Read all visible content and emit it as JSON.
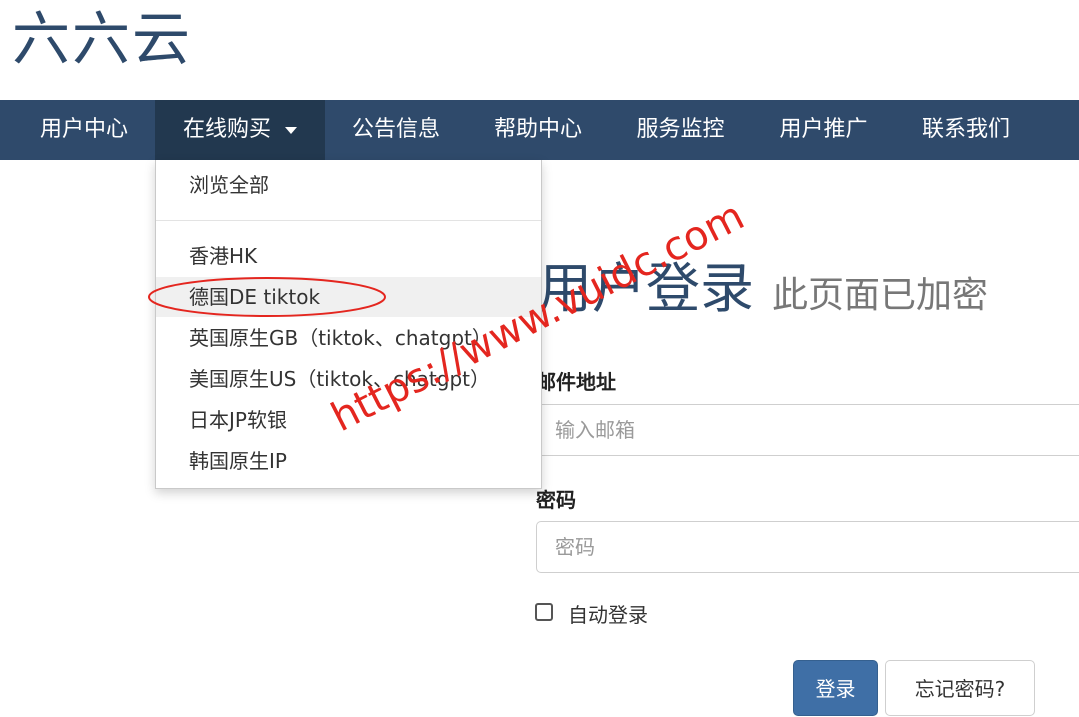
{
  "brand": {
    "name": "六六云"
  },
  "nav": {
    "items": [
      {
        "label": "用户中心"
      },
      {
        "label": "在线购买"
      },
      {
        "label": "公告信息"
      },
      {
        "label": "帮助中心"
      },
      {
        "label": "服务监控"
      },
      {
        "label": "用户推广"
      },
      {
        "label": "联系我们"
      }
    ],
    "dropdown": [
      {
        "label": "浏览全部"
      },
      {
        "label": "香港HK"
      },
      {
        "label": "德国DE tiktok"
      },
      {
        "label": "英国原生GB（tiktok、chatgpt）"
      },
      {
        "label": "美国原生US（tiktok、chatgpt）"
      },
      {
        "label": "日本JP软银"
      },
      {
        "label": "韩国原生IP"
      }
    ]
  },
  "login": {
    "title": "用户登录",
    "subtitle": "此页面已加密",
    "email_label": "邮件地址",
    "email_placeholder": "输入邮箱",
    "password_label": "密码",
    "password_placeholder": "密码",
    "remember_label": "自动登录",
    "submit_label": "登录",
    "forgot_label": "忘记密码?"
  },
  "watermark": {
    "text": "https://www.vuidc.com"
  },
  "colors": {
    "navbar": "#2f4a6b",
    "accent": "#3f6fa6",
    "annotation": "#e4261f"
  }
}
